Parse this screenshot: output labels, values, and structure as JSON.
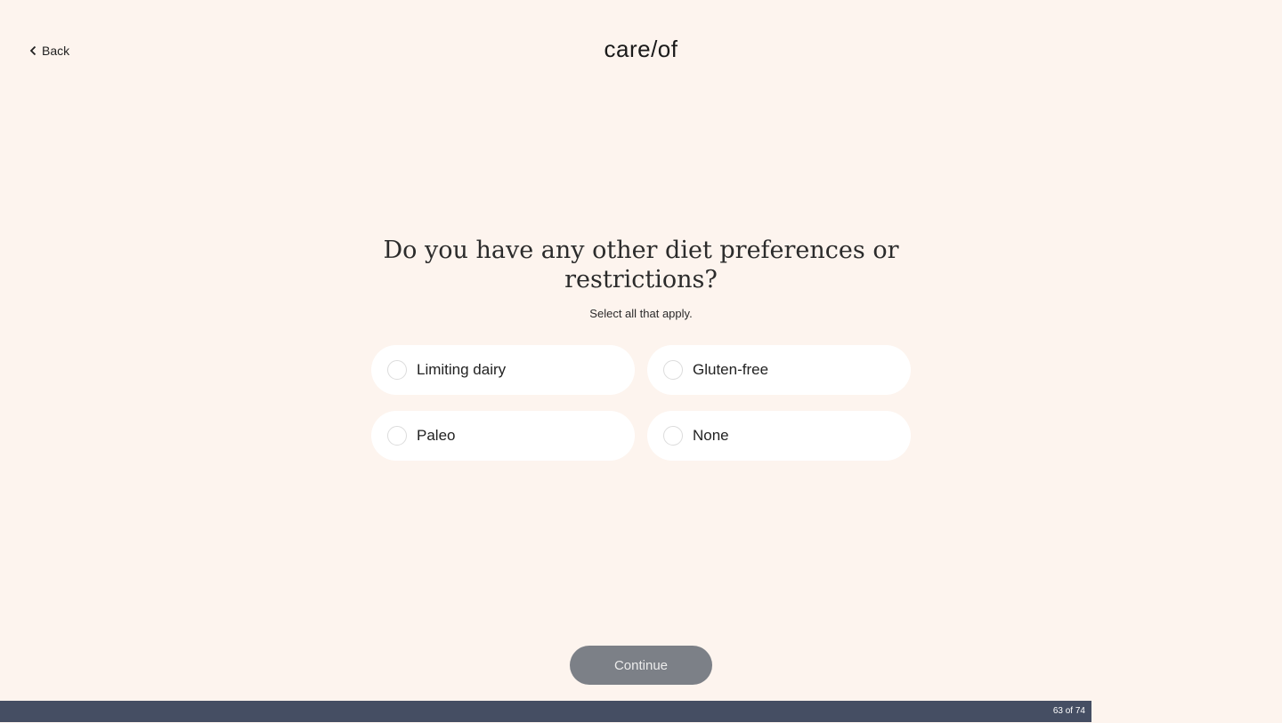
{
  "header": {
    "back_label": "Back",
    "logo_text": "care/of"
  },
  "question": {
    "title": "Do you have any other diet preferences or restrictions?",
    "subtitle": "Select all that apply."
  },
  "options": [
    {
      "label": "Limiting dairy",
      "selected": false
    },
    {
      "label": "Gluten-free",
      "selected": false
    },
    {
      "label": "Paleo",
      "selected": false
    },
    {
      "label": "None",
      "selected": false
    }
  ],
  "footer": {
    "continue_label": "Continue",
    "progress_text": "63 of 74",
    "progress_current": 63,
    "progress_total": 74
  },
  "colors": {
    "background": "#fdf4ee",
    "option_bg": "#ffffff",
    "button_disabled": "#7c8087",
    "progress_bar": "#454e63"
  }
}
